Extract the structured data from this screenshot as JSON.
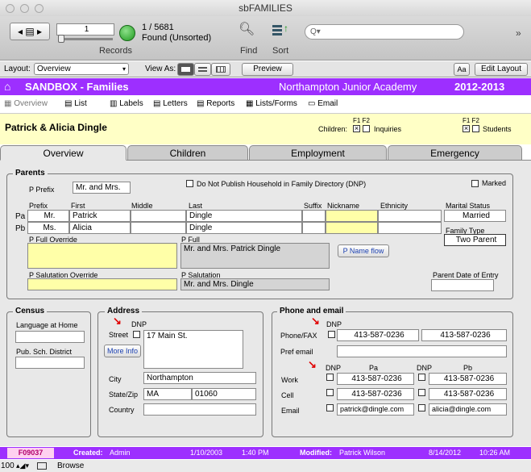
{
  "window": {
    "title": "sbFAMILIES"
  },
  "toolbar": {
    "record_field": "1",
    "record_counter": "1 / 5681",
    "found_status": "Found (Unsorted)",
    "records_label": "Records",
    "find_label": "Find",
    "sort_label": "Sort",
    "search_placeholder": "Q▾"
  },
  "layoutbar": {
    "layout_label": "Layout:",
    "layout_value": "Overview",
    "view_as_label": "View As:",
    "preview_label": "Preview",
    "aa_label": "Aa",
    "edit_layout_label": "Edit Layout"
  },
  "header": {
    "app_name": "SANDBOX - Families",
    "school": "Northampton Junior Academy",
    "year": "2012-2013"
  },
  "nav": {
    "overview": "Overview",
    "list": "List",
    "labels": "Labels",
    "letters": "Letters",
    "reports": "Reports",
    "lists_forms": "Lists/Forms",
    "email": "Email"
  },
  "family": {
    "name": "Patrick & Alicia Dingle",
    "children_label": "Children:",
    "inquiries_label": "Inquiries",
    "students_label": "Students",
    "f1f2": "F1 F2"
  },
  "tabs": [
    "Overview",
    "Children",
    "Employment",
    "Emergency"
  ],
  "parents": {
    "title": "Parents",
    "prefix_label": "P Prefix",
    "prefix_value": "Mr. and Mrs.",
    "dnp_label": "Do Not Publish Household in Family Directory (DNP)",
    "marked_label": "Marked",
    "col_prefix": "Prefix",
    "col_first": "First",
    "col_middle": "Middle",
    "col_last": "Last",
    "col_suffix": "Suffix",
    "col_nickname": "Nickname",
    "col_ethnicity": "Ethnicity",
    "pa_label": "Pa",
    "pb_label": "Pb",
    "pa": {
      "prefix": "Mr.",
      "first": "Patrick",
      "middle": "",
      "last": "Dingle"
    },
    "pb": {
      "prefix": "Ms.",
      "first": "Alicia",
      "middle": "",
      "last": "Dingle"
    },
    "marital_label": "Marital Status",
    "marital_value": "Married",
    "family_type_label": "Family Type",
    "family_type_value": "Two Parent",
    "full_override_label": "P Full Override",
    "full_label": "P Full",
    "full_value": "Mr. and Mrs. Patrick Dingle",
    "name_flow_label": "P Name flow",
    "sal_override_label": "P Salutation Override",
    "sal_label": "P Salutation",
    "sal_value": "Mr. and Mrs. Dingle",
    "entry_date_label": "Parent Date of Entry"
  },
  "census": {
    "title": "Census",
    "language_label": "Language at Home",
    "district_label": "Pub. Sch. District"
  },
  "address": {
    "title": "Address",
    "dnp_label": "DNP",
    "street_label": "Street",
    "street_value": "17 Main St.",
    "more_info_label": "More Info",
    "city_label": "City",
    "city_value": "Northampton",
    "state_zip_label": "State/Zip",
    "state_value": "MA",
    "zip_value": "01060",
    "country_label": "Country"
  },
  "phone": {
    "title": "Phone and email",
    "dnp_label": "DNP",
    "phone_fax_label": "Phone/FAX",
    "phone1": "413-587-0236",
    "phone2": "413-587-0236",
    "pref_email_label": "Pref email",
    "pa_label": "Pa",
    "pb_label": "Pb",
    "work_label": "Work",
    "cell_label": "Cell",
    "email_label": "Email",
    "pa_work": "413-587-0236",
    "pa_cell": "413-587-0236",
    "pa_email": "patrick@dingle.com",
    "pb_work": "413-587-0236",
    "pb_cell": "413-587-0236",
    "pb_email": "alicia@dingle.com"
  },
  "status": {
    "record_id": "F09037",
    "created_label": "Created:",
    "created_by": "Admin",
    "created_date": "1/10/2003",
    "created_time": "1:40 PM",
    "modified_label": "Modified:",
    "modified_by": "Patrick Wilson",
    "modified_date": "8/14/2012",
    "modified_time": "10:26 AM"
  },
  "bottom": {
    "zoom": "100",
    "mode": "Browse"
  }
}
